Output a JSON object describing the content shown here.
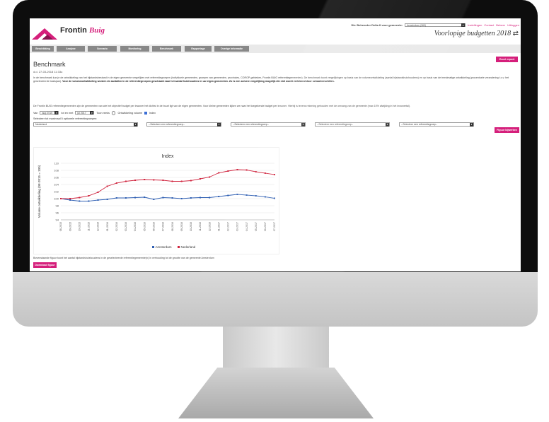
{
  "header": {
    "brand": "Frontin",
    "brand_italic": "Buig",
    "role_label": "Db: Beheerder Delta II voor gemeente:",
    "municipality": "Amsterdam (363)",
    "links": [
      "Instellingen",
      "Contact",
      "Beheer",
      "Uitloggen"
    ],
    "subtitle": "Voorlopige budgetten 2018"
  },
  "tabs": [
    "Beschikking",
    "Analyse",
    "Scenario",
    "Monitoring",
    "Benchmark",
    "Rapportage",
    "Overige informatie"
  ],
  "page": {
    "title": "Benchmark",
    "excel_button": "Excel export",
    "date": "d.d. 27-03-2018 11:33u",
    "intro_plain": "In de benchmark kun je de ontwikkeling van het bijstandsbestand in de eigen gemeente vergelijken met referentiegroepen (individuele gemeenten, groepen van gemeenten, provincies, COROP-gebieden, Frontin BUIG referentiegemeenten). De benchmark toont vergelijkingen op basis van de volumeontwikkeling (aantal bijstandshuishoudens) en op basis van de trendmatige ontwikkeling (procentuele verandering t.o.v. het geselecteerde basisjaar).",
    "intro_bold": "Voor de volumeontwikkeling worden de aantallen in de referentiegroepen geschaald naar het aantal huishoudens in uw eigen gemeenten. Zo is een zuivere vergelijking mogelijk die niet wordt vertekend door schaalverschillen.",
    "note": "De Frontin BUIG referentiegemeenten zijn de gemeenten van wie het objectief budget per inwoner het dichtst in de buurt ligt van de eigen gemeenten. Voor kleine gemeenten kijken we naar het toegekende budget per inwoner. Hierbij is tevens rekening gehouden met de omvang van de gemeente (max 10% afwijking in het inwonertal)."
  },
  "period": {
    "from_label": "Van",
    "from_value": "aug 2015",
    "to_label": "tot en met",
    "to_value": "jul 2017",
    "show_label": "Toon reeks",
    "option_volume": "Ontwikkeling volume",
    "option_index": "Index"
  },
  "reference": {
    "label": "Selecteer tot maximaal 5 optionele referentiegroepen:",
    "selects": [
      "Nederland",
      "--Selecteer een referentiegroep--",
      "--Selecteer een referentiegroep--",
      "--Selecteer een referentiegroep--",
      "--Selecteer een referentiegroep--"
    ],
    "button": "Figuur bijwerken"
  },
  "chart_data": {
    "type": "line",
    "title": "Index",
    "ylabel": "Volume ontwikkeling (08-2015 = 100)",
    "ylim": [
      94,
      110
    ],
    "yticks": [
      94,
      96,
      98,
      100,
      102,
      104,
      106,
      108,
      110
    ],
    "grid": true,
    "legend_position": "bottom",
    "x": [
      "08-2015",
      "09-2015",
      "10-2015",
      "11-2015",
      "12-2015",
      "01-2016",
      "02-2016",
      "03-2016",
      "04-2016",
      "05-2016",
      "06-2016",
      "07-2016",
      "08-2016",
      "09-2016",
      "10-2016",
      "11-2016",
      "12-2016",
      "01-2017",
      "02-2017",
      "03-2017",
      "04-2017",
      "05-2017",
      "06-2017",
      "07-2017"
    ],
    "series": [
      {
        "name": "Amsterdam",
        "color": "#2f5fb3",
        "values": [
          100,
          99.6,
          99.3,
          99.3,
          99.6,
          99.8,
          100.2,
          100.2,
          100.3,
          100.4,
          99.8,
          100.3,
          100.2,
          100.0,
          100.2,
          100.3,
          100.3,
          100.6,
          100.9,
          101.2,
          101.0,
          100.8,
          100.5,
          100.1
        ]
      },
      {
        "name": "Nederland",
        "color": "#d0243e",
        "values": [
          100,
          100.0,
          100.3,
          100.8,
          101.8,
          103.5,
          104.4,
          104.9,
          105.2,
          105.4,
          105.3,
          105.2,
          104.9,
          104.9,
          105.1,
          105.6,
          106.1,
          107.3,
          107.8,
          108.2,
          108.1,
          107.6,
          107.2,
          106.8
        ]
      }
    ]
  },
  "footer": {
    "caption": "Bovenstaande figuur toont het aantal bijstandshuishoudens in de geselecteerde referentiegemeente(n) in verhouding tot de grootte van de gemeente Amsterdam",
    "download_button": "Download figuur"
  }
}
